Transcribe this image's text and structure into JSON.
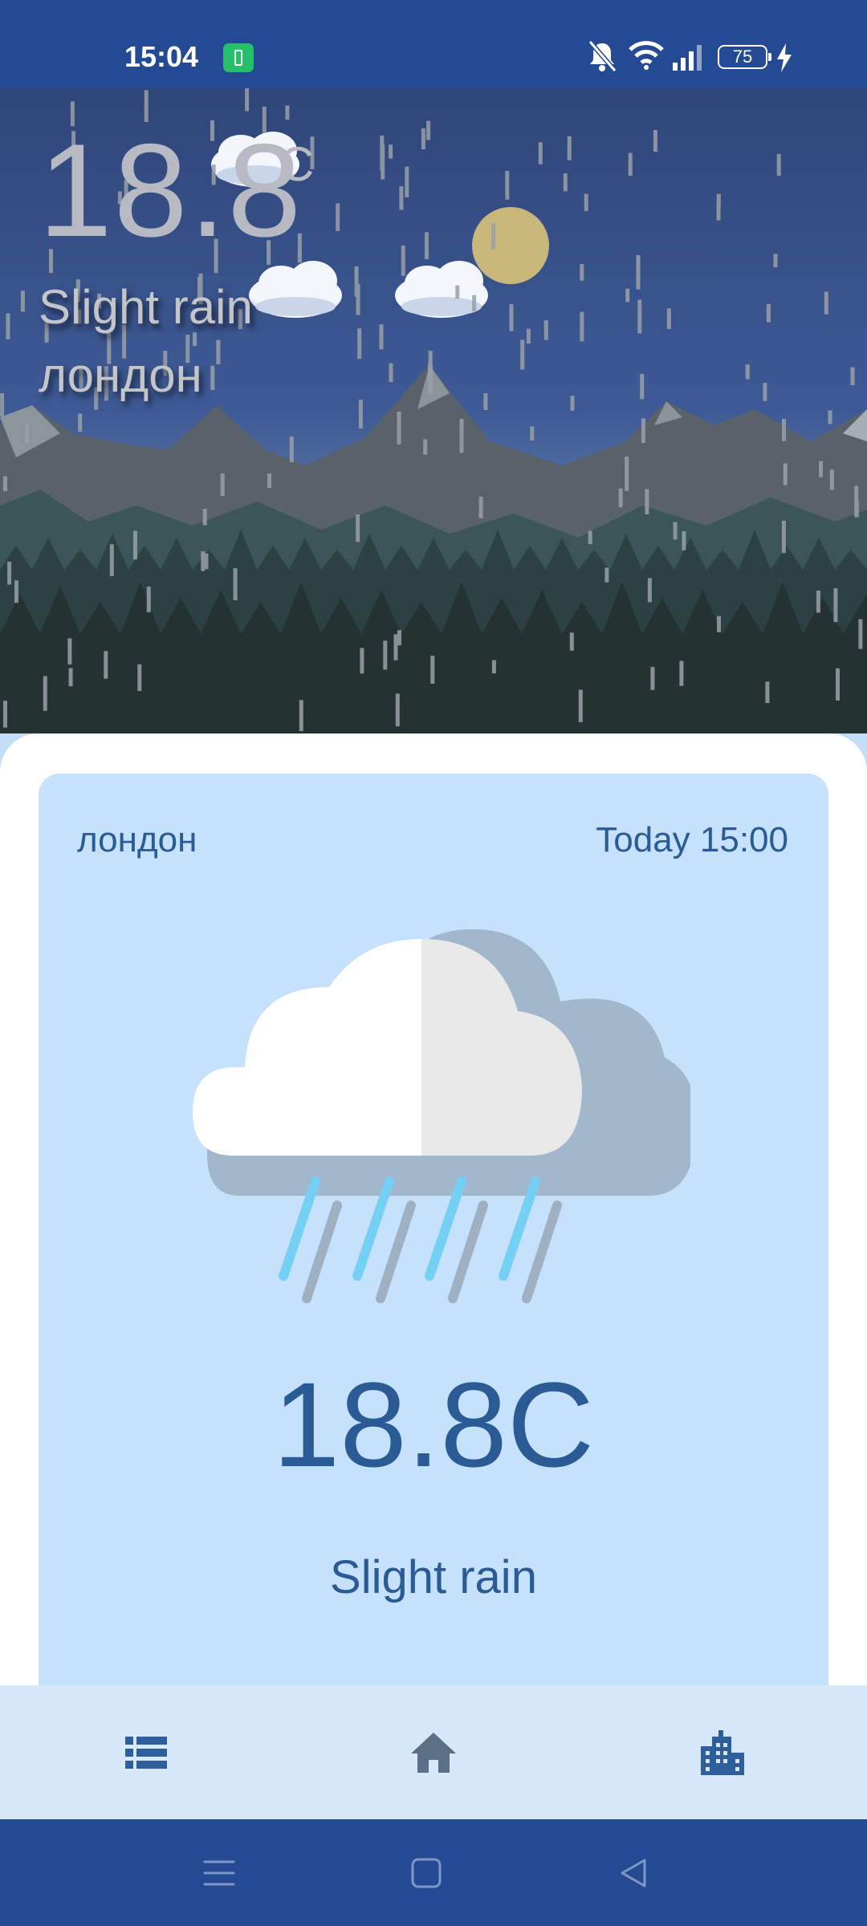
{
  "status": {
    "time": "15:04",
    "battery_level": "75",
    "icons": [
      "battery-saver-icon",
      "bell-off-icon",
      "wifi-icon",
      "signal-icon",
      "battery-icon",
      "charging-icon"
    ]
  },
  "hero": {
    "temp": "18.8",
    "unit": "C",
    "condition": "Slight rain",
    "city": "лондон"
  },
  "card": {
    "city": "лондон",
    "time": "Today 15:00",
    "temp": "18.8C",
    "condition": "Slight rain",
    "icon": "rain-cloud-icon"
  },
  "bottom_nav": {
    "items": [
      "list-icon",
      "home-icon",
      "city-icon"
    ]
  },
  "system_nav": {
    "items": [
      "menu-icon",
      "home-square-icon",
      "back-icon"
    ]
  },
  "colors": {
    "status_bar": "#244a93",
    "card_bg": "#c5e1fb",
    "accent_text": "#2a5b94",
    "nav_bg": "#d6e8fa"
  }
}
